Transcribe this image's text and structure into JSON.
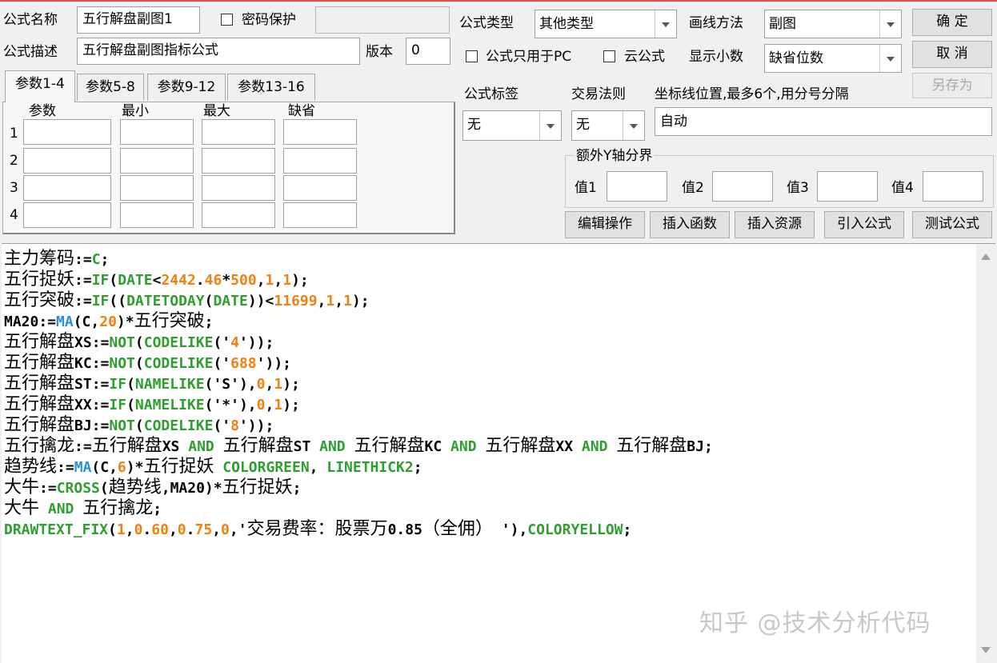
{
  "header": {
    "name_label": "公式名称",
    "name_value": "五行解盘副图1",
    "password_label": "密码保护",
    "desc_label": "公式描述",
    "desc_value": "五行解盘副图指标公式",
    "version_label": "版本",
    "version_value": "0",
    "type_label": "公式类型",
    "type_value": "其他类型",
    "draw_label": "画线方法",
    "draw_value": "副图",
    "pc_only_label": "公式只用于PC",
    "cloud_label": "云公式",
    "decimals_label": "显示小数",
    "decimals_value": "缺省位数"
  },
  "buttons": {
    "ok": "确  定",
    "cancel": "取  消",
    "save_as": "另存为",
    "edit_ops": "编辑操作",
    "insert_func": "插入函数",
    "insert_res": "插入资源",
    "import_formula": "引入公式",
    "test_formula": "测试公式"
  },
  "tabs": [
    "参数1-4",
    "参数5-8",
    "参数9-12",
    "参数13-16"
  ],
  "params": {
    "headers": [
      "参数",
      "最小",
      "最大",
      "缺省"
    ],
    "rows": [
      "1",
      "2",
      "3",
      "4"
    ]
  },
  "tagging": {
    "tag_label": "公式标签",
    "tag_value": "无",
    "rule_label": "交易法则",
    "rule_value": "无",
    "axis_label": "坐标线位置,最多6个,用分号分隔",
    "axis_value": "自动"
  },
  "yaxis": {
    "title": "额外Y轴分界",
    "v1": "值1",
    "v2": "值2",
    "v3": "值3",
    "v4": "值4"
  },
  "code_lines": [
    [
      [
        "cn",
        "主力筹码"
      ],
      [
        "t",
        ":="
      ],
      [
        "g",
        "C"
      ],
      [
        "t",
        ";"
      ]
    ],
    [
      [
        "cn",
        "五行捉妖"
      ],
      [
        "t",
        ":="
      ],
      [
        "g",
        "IF"
      ],
      [
        "t",
        "("
      ],
      [
        "g",
        "DATE"
      ],
      [
        "t",
        "<"
      ],
      [
        "n",
        "2442"
      ],
      [
        "t",
        "."
      ],
      [
        "n",
        "46"
      ],
      [
        "t",
        "*"
      ],
      [
        "n",
        "500"
      ],
      [
        "t",
        ","
      ],
      [
        "n",
        "1"
      ],
      [
        "t",
        ","
      ],
      [
        "n",
        "1"
      ],
      [
        "t",
        ");"
      ]
    ],
    [
      [
        "cn",
        "五行突破"
      ],
      [
        "t",
        ":="
      ],
      [
        "g",
        "IF"
      ],
      [
        "t",
        "(("
      ],
      [
        "g",
        "DATETODAY"
      ],
      [
        "t",
        "("
      ],
      [
        "g",
        "DATE"
      ],
      [
        "t",
        "))<"
      ],
      [
        "n",
        "11699"
      ],
      [
        "t",
        ","
      ],
      [
        "n",
        "1"
      ],
      [
        "t",
        ","
      ],
      [
        "n",
        "1"
      ],
      [
        "t",
        ");"
      ]
    ],
    [
      [
        "t",
        "MA20:="
      ],
      [
        "b",
        "MA"
      ],
      [
        "t",
        "(C,"
      ],
      [
        "n",
        "20"
      ],
      [
        "t",
        ")*"
      ],
      [
        "cn",
        "五行突破"
      ],
      [
        "t",
        ";"
      ]
    ],
    [
      [
        "cn",
        "五行解盘"
      ],
      [
        "t",
        "XS:="
      ],
      [
        "g",
        "NOT"
      ],
      [
        "t",
        "("
      ],
      [
        "g",
        "CODELIKE"
      ],
      [
        "t",
        "('"
      ],
      [
        "n",
        "4"
      ],
      [
        "t",
        "'));"
      ]
    ],
    [
      [
        "cn",
        "五行解盘"
      ],
      [
        "t",
        "KC:="
      ],
      [
        "g",
        "NOT"
      ],
      [
        "t",
        "("
      ],
      [
        "g",
        "CODELIKE"
      ],
      [
        "t",
        "('"
      ],
      [
        "n",
        "688"
      ],
      [
        "t",
        "'));"
      ]
    ],
    [
      [
        "cn",
        "五行解盘"
      ],
      [
        "t",
        "ST:="
      ],
      [
        "g",
        "IF"
      ],
      [
        "t",
        "("
      ],
      [
        "g",
        "NAMELIKE"
      ],
      [
        "t",
        "('S'),"
      ],
      [
        "n",
        "0"
      ],
      [
        "t",
        ","
      ],
      [
        "n",
        "1"
      ],
      [
        "t",
        ");"
      ]
    ],
    [
      [
        "cn",
        "五行解盘"
      ],
      [
        "t",
        "XX:="
      ],
      [
        "g",
        "IF"
      ],
      [
        "t",
        "("
      ],
      [
        "g",
        "NAMELIKE"
      ],
      [
        "t",
        "('*'),"
      ],
      [
        "n",
        "0"
      ],
      [
        "t",
        ","
      ],
      [
        "n",
        "1"
      ],
      [
        "t",
        ");"
      ]
    ],
    [
      [
        "cn",
        "五行解盘"
      ],
      [
        "t",
        "BJ:="
      ],
      [
        "g",
        "NOT"
      ],
      [
        "t",
        "("
      ],
      [
        "g",
        "CODELIKE"
      ],
      [
        "t",
        "('"
      ],
      [
        "n",
        "8"
      ],
      [
        "t",
        "'));"
      ]
    ],
    [
      [
        "cn",
        "五行擒龙"
      ],
      [
        "t",
        ":="
      ],
      [
        "cn",
        "五行解盘"
      ],
      [
        "t",
        "XS "
      ],
      [
        "g",
        "AND"
      ],
      [
        "t",
        " "
      ],
      [
        "cn",
        "五行解盘"
      ],
      [
        "t",
        "ST "
      ],
      [
        "g",
        "AND"
      ],
      [
        "t",
        " "
      ],
      [
        "cn",
        "五行解盘"
      ],
      [
        "t",
        "KC "
      ],
      [
        "g",
        "AND"
      ],
      [
        "t",
        " "
      ],
      [
        "cn",
        "五行解盘"
      ],
      [
        "t",
        "XX "
      ],
      [
        "g",
        "AND"
      ],
      [
        "t",
        " "
      ],
      [
        "cn",
        "五行解盘"
      ],
      [
        "t",
        "BJ;"
      ]
    ],
    [
      [
        "cn",
        "趋势线"
      ],
      [
        "t",
        ":="
      ],
      [
        "b",
        "MA"
      ],
      [
        "t",
        "(C,"
      ],
      [
        "n",
        "6"
      ],
      [
        "t",
        ")*"
      ],
      [
        "cn",
        "五行捉妖"
      ],
      [
        "t",
        " "
      ],
      [
        "g",
        "COLORGREEN"
      ],
      [
        "t",
        ", "
      ],
      [
        "g",
        "LINETHICK2"
      ],
      [
        "t",
        ";"
      ]
    ],
    [
      [
        "cn",
        "大牛"
      ],
      [
        "t",
        ":="
      ],
      [
        "g",
        "CROSS"
      ],
      [
        "t",
        "("
      ],
      [
        "cn",
        "趋势线"
      ],
      [
        "t",
        ",MA20)*"
      ],
      [
        "cn",
        "五行捉妖"
      ],
      [
        "t",
        ";"
      ]
    ],
    [
      [
        "cn",
        "大牛"
      ],
      [
        "t",
        " "
      ],
      [
        "g",
        "AND"
      ],
      [
        "t",
        " "
      ],
      [
        "cn",
        "五行擒龙"
      ],
      [
        "t",
        ";"
      ]
    ],
    [
      [
        "g",
        "DRAWTEXT_FIX"
      ],
      [
        "t",
        "("
      ],
      [
        "n",
        "1"
      ],
      [
        "t",
        ","
      ],
      [
        "n",
        "0"
      ],
      [
        "t",
        "."
      ],
      [
        "n",
        "60"
      ],
      [
        "t",
        ","
      ],
      [
        "n",
        "0"
      ],
      [
        "t",
        "."
      ],
      [
        "n",
        "75"
      ],
      [
        "t",
        ","
      ],
      [
        "n",
        "0"
      ],
      [
        "t",
        ",'"
      ],
      [
        "cn",
        "交易费率：股票万"
      ],
      [
        "t",
        "0.85"
      ],
      [
        "cn",
        "（全佣）"
      ],
      [
        "t",
        " '),"
      ],
      [
        "g",
        "COLORYELLOW"
      ],
      [
        "t",
        ";"
      ]
    ]
  ],
  "watermark": "知乎 @技术分析代码",
  "colors": {
    "keyword": "#2e9e2e",
    "function_blue": "#2a8fd8",
    "number": "#f08010"
  }
}
